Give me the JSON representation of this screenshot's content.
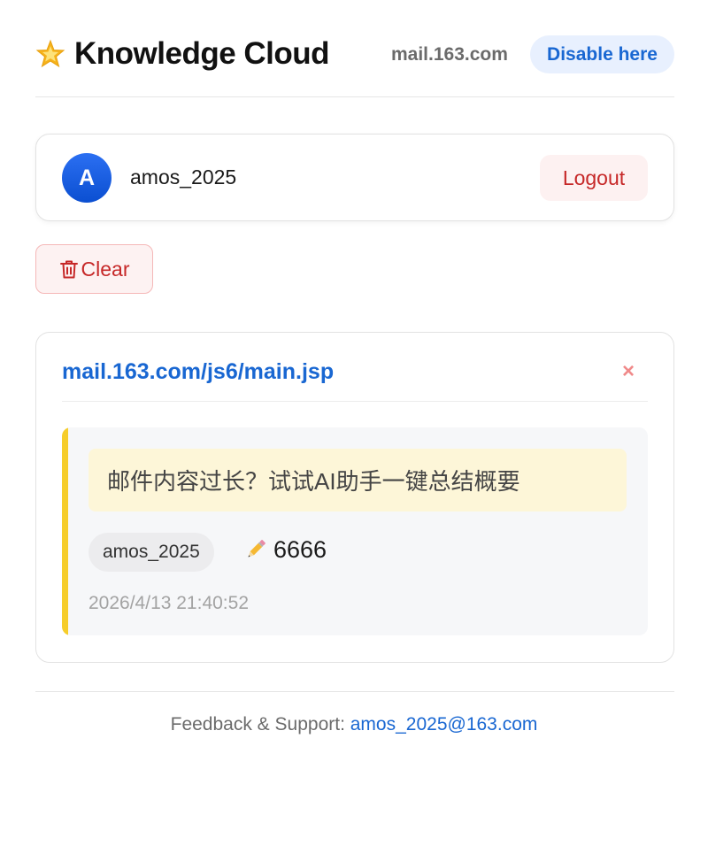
{
  "header": {
    "brand_icon": "star-icon",
    "title": "Knowledge Cloud",
    "site_domain": "mail.163.com",
    "disable_label": "Disable here"
  },
  "user": {
    "avatar_letter": "A",
    "username": "amos_2025",
    "logout_label": "Logout"
  },
  "actions": {
    "clear_icon": "trash-icon",
    "clear_label": "Clear"
  },
  "note": {
    "url": "mail.163.com/js6/main.jsp",
    "close_symbol": "×",
    "quote": "邮件内容过长？试试AI助手一键总结概要",
    "author": "amos_2025",
    "edit_icon": "pencil-icon",
    "comment": "6666",
    "timestamp": "2026/4/13 21:40:52"
  },
  "footer": {
    "label": "Feedback & Support: ",
    "email": "amos_2025@163.com"
  },
  "colors": {
    "accent_blue": "#1967d2",
    "danger_red": "#c62828",
    "highlight_yellow": "#f6cd2a"
  }
}
